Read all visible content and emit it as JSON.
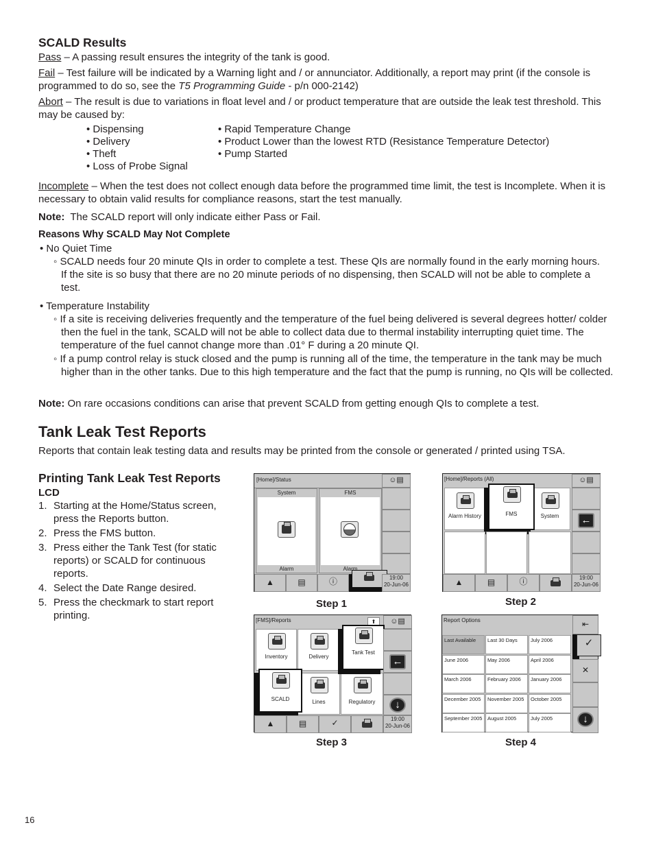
{
  "scald": {
    "heading": "SCALD Results",
    "pass_term": "Pass",
    "pass_text": " – A passing result ensures the integrity of the tank is good.",
    "fail_term": "Fail",
    "fail_text": " – Test failure will be indicated by a Warning light and / or annunciator. Additionally, a report may print (if the console is programmed to do so, see the ",
    "fail_guide": "T5 Programming Guide",
    "fail_tail": " - p/n 000-2142)",
    "abort_term": "Abort",
    "abort_text": " – The result is due to variations in float level and / or product temperature that are outside the leak test threshold. This may be caused by:",
    "causes_left": [
      "Dispensing",
      "Delivery",
      "Theft",
      "Loss of Probe Signal"
    ],
    "causes_right": [
      "Rapid Temperature Change",
      "Product Lower than the lowest RTD (Resistance Temperature Detector)",
      "Pump Started"
    ],
    "incomplete_term": "Incomplete",
    "incomplete_text": " – When the test does not collect enough data before the programmed time limit, the test is Incomplete. When it is necessary to obtain valid results for compliance reasons, start the test manually.",
    "note_label": "Note:",
    "note_text": "  The SCALD report will only indicate either Pass or Fail.",
    "reasons_heading": "Reasons Why SCALD May Not Complete",
    "reason1": "• No Quiet Time",
    "reason1_sub": "◦ SCALD needs four 20 minute QIs in order to complete a test. These QIs are normally found in the early morning hours. If the site is so busy that there are no 20 minute periods of no dispensing, then SCALD will not be able to complete a test.",
    "reason2": "• Temperature Instability",
    "reason2_sub1": "◦ If a site is receiving deliveries frequently and the temperature of the fuel being delivered is several degrees hotter/ colder then the fuel in the tank, SCALD will not be able to collect data due to thermal instability interrupting quiet time. The temperature of the fuel cannot change more than .01° F during a 20 minute QI.",
    "reason2_sub2": "◦ If a pump control relay is stuck closed and the pump is running all of the time, the temperature in the tank may be much higher than in the other tanks. Due to this high temperature and the fact that the pump is running, no QIs will be collected.",
    "note2_label": "Note:",
    "note2_text": " On rare occasions conditions can arise that prevent SCALD from getting enough QIs to complete a test."
  },
  "tank": {
    "heading": "Tank Leak Test Reports",
    "intro": "Reports that contain leak testing data and results may be printed from the console or generated / printed using TSA.",
    "printing_heading": "Printing Tank Leak Test Reports",
    "lcd": "LCD",
    "steps": [
      "Starting at the Home/Status screen, press the Reports button.",
      "Press the FMS button.",
      "Press either the Tank Test (for static reports) or SCALD for continuous reports.",
      "Select the Date Range desired.",
      "Press the checkmark to start report printing."
    ]
  },
  "screens": {
    "time": "19:00",
    "date": "20-Jun-06",
    "s1": {
      "title": "[Home]/Status",
      "col1": "System",
      "col2": "FMS",
      "alarm1": "Alarm",
      "alarm2": "Alarm",
      "caption": "Step 1"
    },
    "s2": {
      "title": "[Home]/Reports (All)",
      "b1": "Alarm History",
      "b2": "FMS",
      "b3": "System",
      "caption": "Step 2"
    },
    "s3": {
      "title": "[FMS]/Reports",
      "b1": "Inventory",
      "b2": "Delivery",
      "b3": "Tank Test",
      "b4": "SCALD",
      "b5": "Lines",
      "b6": "Regulatory",
      "caption": "Step 3"
    },
    "s4": {
      "title": "Report Options",
      "options": [
        "Last Available",
        "Last 30 Days",
        "July 2006",
        "June 2006",
        "May 2006",
        "April 2006",
        "March 2006",
        "February 2006",
        "January 2006",
        "December 2005",
        "November 2005",
        "October 2005",
        "September 2005",
        "August 2005",
        "July 2005"
      ],
      "caption": "Step 4"
    }
  },
  "page_number": "16"
}
